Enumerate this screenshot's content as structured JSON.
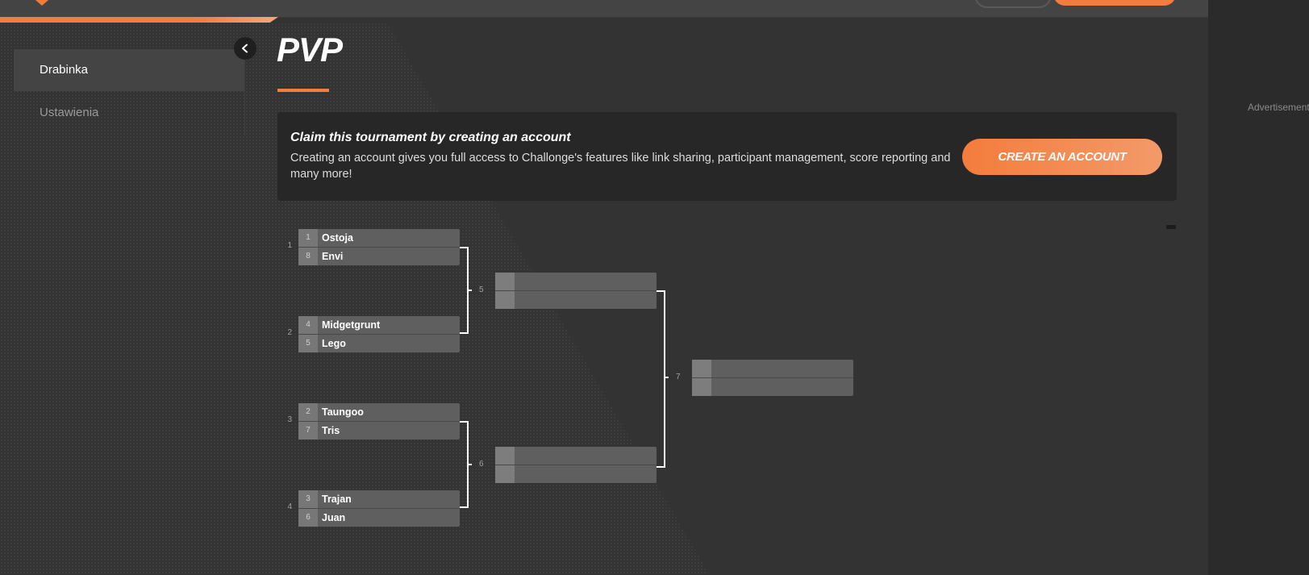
{
  "app": {
    "accent_color": "#f47c3c",
    "background": "#333333"
  },
  "sidebar": {
    "items": [
      {
        "label": "Drabinka",
        "active": true
      },
      {
        "label": "Ustawienia",
        "active": false
      }
    ],
    "collapse_icon": "chevron-left-icon"
  },
  "page": {
    "title": "PVP"
  },
  "claim": {
    "heading": "Claim this tournament by creating an account",
    "text": "Creating an account gives you full access to Challonge's features like link sharing, participant management, score reporting and many more!",
    "button_label": "CREATE AN ACCOUNT"
  },
  "ads": {
    "label": "Advertisement"
  },
  "bracket": {
    "round1": [
      {
        "number": "1",
        "players": [
          {
            "seed": "1",
            "name": "Ostoja"
          },
          {
            "seed": "8",
            "name": "Envi"
          }
        ]
      },
      {
        "number": "2",
        "players": [
          {
            "seed": "4",
            "name": "Midgetgrunt"
          },
          {
            "seed": "5",
            "name": "Lego"
          }
        ]
      },
      {
        "number": "3",
        "players": [
          {
            "seed": "2",
            "name": "Taungoo"
          },
          {
            "seed": "7",
            "name": "Tris"
          }
        ]
      },
      {
        "number": "4",
        "players": [
          {
            "seed": "3",
            "name": "Trajan"
          },
          {
            "seed": "6",
            "name": "Juan"
          }
        ]
      }
    ],
    "round2": [
      {
        "number": "5"
      },
      {
        "number": "6"
      }
    ],
    "final": {
      "number": "7"
    }
  }
}
